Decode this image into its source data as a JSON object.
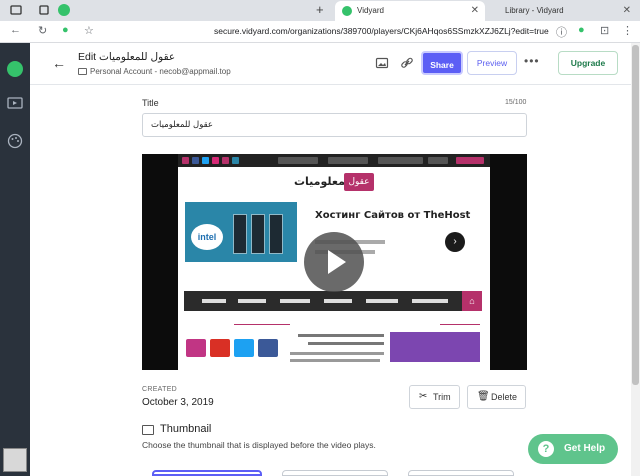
{
  "browser": {
    "tabs": [
      {
        "title": "Vidyard",
        "active": true
      },
      {
        "title": "Library - Vidyard",
        "active": false
      }
    ],
    "new_tab_label": "+",
    "url": "secure.vidyard.com/organizations/389700/players/CKj6AHqos6SSmzkXZJ6ZLj?edit=true"
  },
  "header": {
    "title": "Edit عقول للمعلوميات",
    "subtitle": "Personal Account - necob@appmail.top",
    "share_label": "Share",
    "preview_label": "Preview",
    "upgrade_label": "Upgrade",
    "more_label": "•••"
  },
  "form": {
    "title_label": "Title",
    "title_counter": "15/100",
    "title_value": "عقول للمعلوميات"
  },
  "video": {
    "site_logo_text": "للمعلوميات",
    "site_logo_badge": "عقول",
    "ad_headline": "Хостинг Сайтов от TheHost"
  },
  "details": {
    "created_label": "CREATED",
    "created_value": "October 3, 2019",
    "trim_label": "Trim",
    "delete_label": "Delete"
  },
  "thumbnail": {
    "title": "Thumbnail",
    "description": "Choose the thumbnail that is displayed before the video plays."
  },
  "help": {
    "label": "Get Help",
    "icon_glyph": "?"
  },
  "colors": {
    "sidebar": "#2a323c",
    "primary": "#5c5ef5",
    "brand_green": "#35c26b",
    "help_green": "#5fc48c",
    "site_accent": "#b5316a"
  }
}
